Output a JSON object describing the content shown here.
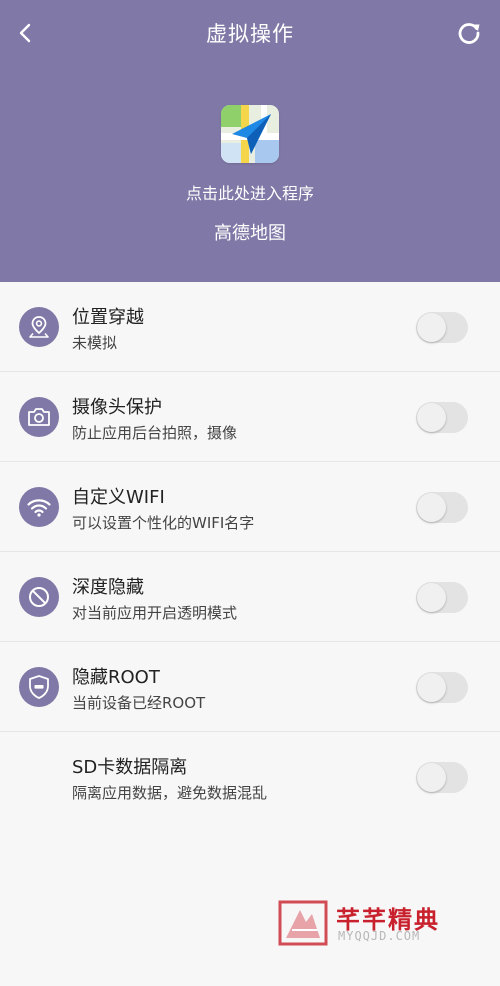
{
  "header": {
    "title": "虚拟操作",
    "app_icon": "amap-logo-icon",
    "enter_text": "点击此处进入程序",
    "app_name": "高德地图"
  },
  "items": [
    {
      "icon": "location-pin-icon",
      "title": "位置穿越",
      "subtitle": "未模拟",
      "enabled": false
    },
    {
      "icon": "camera-icon",
      "title": "摄像头保护",
      "subtitle": "防止应用后台拍照，摄像",
      "enabled": false
    },
    {
      "icon": "wifi-icon",
      "title": "自定义WIFI",
      "subtitle": "可以设置个性化的WIFI名字",
      "enabled": false
    },
    {
      "icon": "hide-icon",
      "title": "深度隐藏",
      "subtitle": "对当前应用开启透明模式",
      "enabled": false
    },
    {
      "icon": "root-shield-icon",
      "title": "隐藏ROOT",
      "subtitle": "当前设备已经ROOT",
      "enabled": false
    },
    {
      "icon": "",
      "title": "SD卡数据隔离",
      "subtitle": "隔离应用数据，避免数据混乱",
      "enabled": false
    }
  ],
  "watermark": {
    "title": "芊芊精典",
    "subtitle": "MYQQJD.COM"
  },
  "colors": {
    "header_bg": "#8078a6",
    "icon_bg": "#8078a6",
    "toggle_off": "#e3e3e3",
    "watermark_red": "#c8202c"
  }
}
